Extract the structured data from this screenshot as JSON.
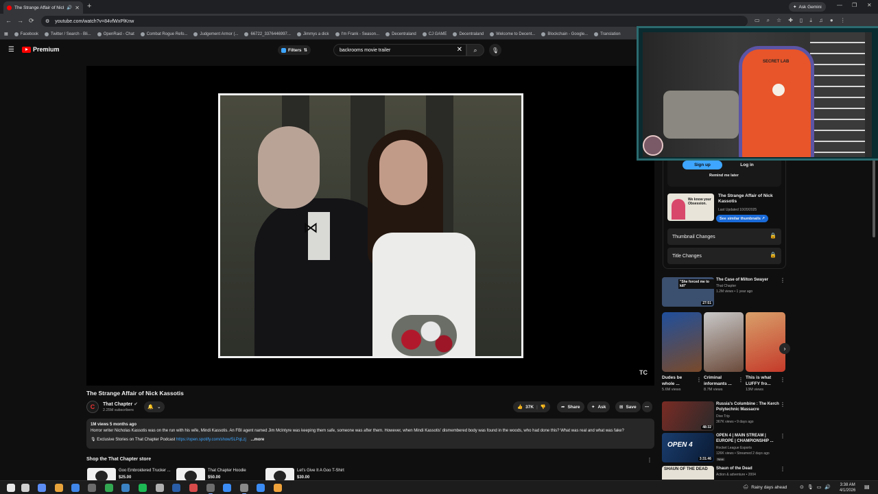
{
  "browser": {
    "tab_title": "The Strange Affair of Nick K",
    "ask_gemini": "Ask Gemini",
    "url": "youtube.com/watch?v=84vfWxPlKnw",
    "bookmarks": [
      "Facebook",
      "Twitter / Search - Bli...",
      "OpenRaid - Chat",
      "Combat Rogue Refo...",
      "Judgement Armor (...",
      "66722_3376446997...",
      "Jimmys a dick",
      "I'm Frank - Season...",
      "Decentraland",
      "CJ GAME",
      "Decentraland",
      "Welcome to Decent...",
      "Blockchain - Google...",
      "Translation"
    ]
  },
  "youtube": {
    "logo_text": "Premium",
    "filters_label": "Filters",
    "search_value": "backrooms movie trailer"
  },
  "video": {
    "watermark": "TC",
    "title": "The Strange Affair of Nick Kassotis",
    "channel_name": "That Chapter",
    "channel_avatar_letter": "C",
    "subscribers": "2.25M subscribers",
    "likes": "37K",
    "share_label": "Share",
    "ask_label": "Ask",
    "save_label": "Save",
    "stats": "1M views  5 months ago",
    "description": "Horror writer Nicholas Kassotis was on the run with his wife, Mindi Kassotis. An FBI agent named Jim McIntyre was keeping them safe, someone was after them. However, when Mindi Kassotis' dismembered body was found in the woods, who had done this? What was real and what was fake?",
    "podcast_text": "🎙 Exclusive Stories on That Chapter Podcast",
    "podcast_link": "https://open.spotify.com/show/5LPqLzj",
    "more_label": "...more"
  },
  "shop": {
    "heading": "Shop the That Chapter store",
    "items": [
      {
        "name": "Goo Embroidered Trucker ...",
        "price": "$25.00"
      },
      {
        "name": "That Chapter Hoodie",
        "price": "$50.00"
      },
      {
        "name": "Let's Give It A Goo T-Shirt",
        "price": "$30.00"
      }
    ]
  },
  "webcam": {
    "chair_brand": "SECRET LAB"
  },
  "sidebar": {
    "signup": "Sign up",
    "login": "Log in",
    "remind": "Remind me later",
    "promo_title": "The Strange Affair of Nick Kassotis",
    "promo_updated": "Last Updated 10/20/2025",
    "promo_thumb_text": "We know your Obsession.",
    "promo_button": "See similar thumbnails ↗",
    "thumb_changes": "Thumbnail Changes",
    "title_changes": "Title Changes",
    "recs": [
      {
        "title": "The Case of Milton Swayer",
        "channel": "That Chapter",
        "meta": "1.2M views • 1 year ago",
        "duration": "27:51",
        "thumb_text": "\"She forced me to kill\"",
        "color": "#3b4f6e"
      },
      {
        "title": "Russia's Columbine : The Kerch Polytechnic Massacre",
        "channel": "Dive Trip",
        "meta": "367K views • 9 days ago",
        "duration": "48:32",
        "thumb_text": "",
        "color": "#7a2b24"
      },
      {
        "title": "OPEN 4 | MAIN STREAM | EUROPE | CHAMPIONSHIP ...",
        "channel": "Rocket League Esports",
        "meta": "126K views • Streamed 2 days ago",
        "duration": "3:31:46",
        "thumb_text": "OPEN 4",
        "color": "#1a3d6e",
        "badge": "New"
      },
      {
        "title": "Shaun of the Dead",
        "channel": "Action & adventure • 2004",
        "meta": "",
        "duration": "",
        "thumb_text": "SHAUN OF THE DEAD",
        "color": "#e6e1d6"
      }
    ],
    "shorts": [
      {
        "title": "Dudes be whole ...",
        "views": "5.6M views",
        "color": "#1f4f9c"
      },
      {
        "title": "Criminal informants ...",
        "views": "8.7M views",
        "color": "#c9c9c9"
      },
      {
        "title": "This is what LUFFY fro...",
        "views": "13M views",
        "color": "#d9a06a"
      }
    ]
  },
  "taskbar": {
    "weather": "Rainy days ahead",
    "time": "3:38 AM",
    "date": "4/1/2026",
    "icon_colors": [
      "#e6e6e6",
      "#d0d0d0",
      "#5b8df5",
      "#e8a33b",
      "#3f86e8",
      "#6b6b6b",
      "#33a852",
      "#3b82c4",
      "#1db954",
      "#b0b0b0",
      "#2a5ea8",
      "#d84b4b",
      "#6d6d6d",
      "#3b8cf5",
      "#8a8a8a",
      "#3b8cf5",
      "#f0a33b"
    ]
  }
}
